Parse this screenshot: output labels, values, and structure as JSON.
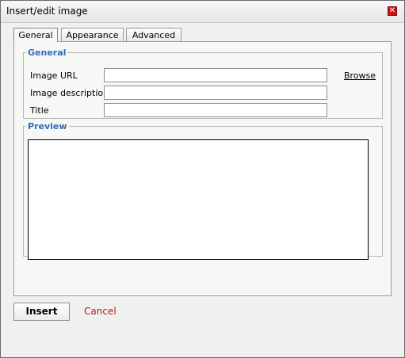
{
  "dialog": {
    "title": "Insert/edit image"
  },
  "tabs": [
    {
      "label": "General",
      "active": true
    },
    {
      "label": "Appearance",
      "active": false
    },
    {
      "label": "Advanced",
      "active": false
    }
  ],
  "general_section": {
    "legend": "General",
    "fields": {
      "image_url": {
        "label": "Image URL",
        "value": ""
      },
      "image_description": {
        "label": "Image description",
        "value": ""
      },
      "title": {
        "label": "Title",
        "value": ""
      }
    },
    "browse_label": "Browse"
  },
  "preview_section": {
    "legend": "Preview"
  },
  "actions": {
    "insert_label": "Insert",
    "cancel_label": "Cancel"
  },
  "colors": {
    "legend": "#2b6fb6",
    "cancel": "#c0141a",
    "close_button": "#c61014"
  },
  "icons": {
    "close": "close-icon"
  }
}
